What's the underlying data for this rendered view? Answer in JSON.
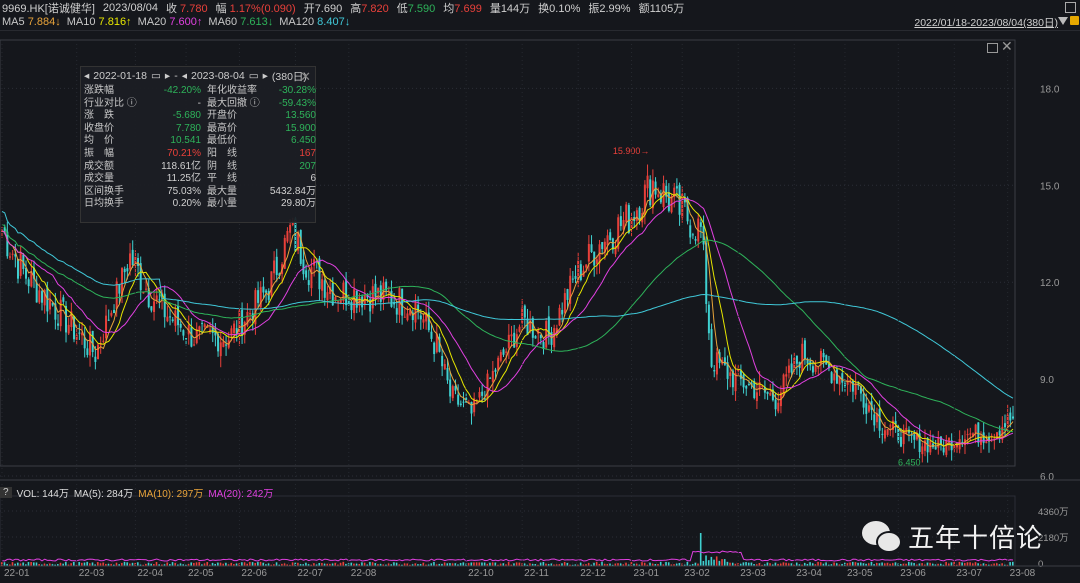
{
  "header": {
    "symbol": "9969.HK[诺诚健华]",
    "date": "2023/08/04",
    "close_label": "收",
    "close": "7.780",
    "chg_label": "幅",
    "chg": "1.17%(0.090)",
    "open_label": "开",
    "open": "7.690",
    "high_label": "高",
    "high": "7.820",
    "low_label": "低",
    "low": "7.590",
    "avg_label": "均",
    "avg": "7.699",
    "vol_label": "量",
    "vol": "144万",
    "turn_label": "换",
    "turn": "0.10%",
    "amp_label": "振",
    "amp": "2.99%",
    "amt_label": "额",
    "amt": "1105万"
  },
  "ma": [
    {
      "label": "MA5",
      "value": "7.884↓",
      "color": "#e8a33a"
    },
    {
      "label": "MA10",
      "value": "7.816↑",
      "color": "#e6e600"
    },
    {
      "label": "MA20",
      "value": "7.600↑",
      "color": "#e040e0"
    },
    {
      "label": "MA60",
      "value": "7.613↓",
      "color": "#2eb35a"
    },
    {
      "label": "MA120",
      "value": "8.407↓",
      "color": "#40c8d8"
    }
  ],
  "range_link": "2022/01/18-2023/08/04(380日)",
  "stats": {
    "start": "2022-01-18",
    "sep": "-",
    "end": "2023-08-04",
    "days": "(380日)",
    "rows": [
      [
        "涨跌幅",
        "-42.20%",
        "年化收益率",
        "-30.28%",
        "g",
        "g"
      ],
      [
        "行业对比 ⓘ",
        "-",
        "最大回撤 ⓘ",
        "-59.43%",
        "w",
        "g"
      ],
      [
        "涨　跌",
        "-5.680",
        "开盘价",
        "13.560",
        "g",
        "g"
      ],
      [
        "收盘价",
        "7.780",
        "最高价",
        "15.900",
        "g",
        "g"
      ],
      [
        "均　价",
        "10.541",
        "最低价",
        "6.450",
        "g",
        "g"
      ],
      [
        "振　幅",
        "70.21%",
        "阳　线",
        "167",
        "rd",
        "rd"
      ],
      [
        "成交额",
        "118.61亿",
        "阴　线",
        "207",
        "w",
        "g"
      ],
      [
        "成交量",
        "11.25亿",
        "平　线",
        "6",
        "w",
        "w"
      ],
      [
        "区间换手",
        "75.03%",
        "最大量",
        "5432.84万",
        "w",
        "w"
      ],
      [
        "日均换手",
        "0.20%",
        "最小量",
        "29.80万",
        "w",
        "w"
      ]
    ]
  },
  "volume": {
    "q": "?",
    "vol": "VOL: 144万",
    "ma5": "MA(5): 284万",
    "ma10": "MA(10): 297万",
    "ma20": "MA(20): 242万",
    "ticks": [
      "4360万",
      "2180万",
      "0"
    ]
  },
  "watermark": "五年十倍论",
  "chart_data": {
    "type": "candlestick",
    "days": 380,
    "price_ticks": [
      6.0,
      9.0,
      12.0,
      15.0,
      18.0
    ],
    "ylim": [
      5.9,
      19.6
    ],
    "x_labels": [
      [
        "22-01",
        0
      ],
      [
        "22-03",
        28
      ],
      [
        "22-04",
        50
      ],
      [
        "22-05",
        69
      ],
      [
        "22-06",
        89
      ],
      [
        "22-07",
        110
      ],
      [
        "22-08",
        130
      ],
      [
        "22-10",
        174
      ],
      [
        "22-11",
        195
      ],
      [
        "22-12",
        216
      ],
      [
        "23-01",
        236
      ],
      [
        "23-02",
        255
      ],
      [
        "23-03",
        276
      ],
      [
        "23-04",
        297
      ],
      [
        "23-05",
        316
      ],
      [
        "23-06",
        336
      ],
      [
        "23-07",
        357
      ],
      [
        "23-08",
        377
      ]
    ],
    "high_mark": {
      "label": "15.900→",
      "day": 244,
      "price": 15.9
    },
    "low_mark": {
      "label": "6.450",
      "day": 349,
      "price": 6.45
    },
    "path": [
      [
        0,
        13.6
      ],
      [
        8,
        12.3
      ],
      [
        20,
        11.2
      ],
      [
        35,
        9.8
      ],
      [
        48,
        12.8
      ],
      [
        55,
        11.7
      ],
      [
        62,
        11.0
      ],
      [
        72,
        10.3
      ],
      [
        85,
        10.3
      ],
      [
        100,
        11.8
      ],
      [
        108,
        13.6
      ],
      [
        115,
        12.5
      ],
      [
        125,
        11.7
      ],
      [
        140,
        11.6
      ],
      [
        155,
        11.3
      ],
      [
        163,
        10.0
      ],
      [
        168,
        8.5
      ],
      [
        176,
        7.9
      ],
      [
        185,
        9.3
      ],
      [
        195,
        10.8
      ],
      [
        205,
        10.3
      ],
      [
        215,
        12.2
      ],
      [
        225,
        13.3
      ],
      [
        235,
        14.0
      ],
      [
        244,
        15.1
      ],
      [
        252,
        14.4
      ],
      [
        262,
        13.6
      ],
      [
        266,
        9.6
      ],
      [
        275,
        9.0
      ],
      [
        290,
        8.4
      ],
      [
        300,
        9.8
      ],
      [
        310,
        9.3
      ],
      [
        320,
        8.8
      ],
      [
        330,
        7.6
      ],
      [
        340,
        7.1
      ],
      [
        348,
        7.0
      ],
      [
        352,
        6.9
      ],
      [
        360,
        7.3
      ],
      [
        370,
        7.3
      ],
      [
        379,
        7.8
      ]
    ]
  }
}
